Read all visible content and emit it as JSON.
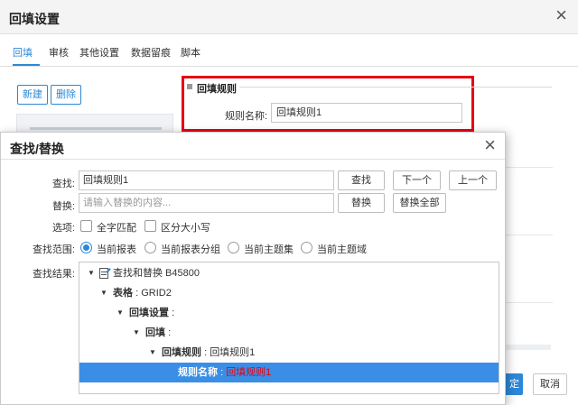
{
  "background_dialog": {
    "title": "回填设置",
    "close_glyph": "×",
    "tabs": [
      {
        "label": "回填",
        "active": true
      },
      {
        "label": "审核",
        "active": false
      },
      {
        "label": "其他设置",
        "active": false
      },
      {
        "label": "数据留痕",
        "active": false
      },
      {
        "label": "脚本",
        "active": false
      }
    ],
    "new_button": "新建",
    "delete_button": "删除",
    "section_title": "回填规则",
    "rule_name_label": "规则名称:",
    "rule_name_value": "回填规则1",
    "confirm_button_fragment": "定",
    "cancel_button": "取消"
  },
  "find_replace": {
    "title": "查找/替换",
    "close_glyph": "×",
    "find_label": "查找:",
    "find_value": "回填规则1",
    "find_button": "查找",
    "next_button": "下一个",
    "prev_button": "上一个",
    "replace_label": "替换:",
    "replace_placeholder": "请输入替换的内容...",
    "replace_button": "替换",
    "replace_all_button": "替换全部",
    "options_label": "选项:",
    "options": [
      {
        "label": "全字匹配",
        "checked": false
      },
      {
        "label": "区分大小写",
        "checked": false
      }
    ],
    "scope_label": "查找范围:",
    "scopes": [
      {
        "label": "当前报表",
        "checked": true
      },
      {
        "label": "当前报表分组",
        "checked": false
      },
      {
        "label": "当前主题集",
        "checked": false
      },
      {
        "label": "当前主题域",
        "checked": false
      }
    ],
    "results_label": "查找结果:",
    "results": {
      "root": "查找和替换 B45800",
      "rows": [
        {
          "key": "表格",
          "sep": ":",
          "value": "GRID2"
        },
        {
          "key": "回填设置",
          "sep": ":",
          "value": ""
        },
        {
          "key": "回填",
          "sep": ":",
          "value": ""
        },
        {
          "key": "回填规则",
          "sep": ":",
          "value": "回填规则1"
        },
        {
          "key": "规则名称",
          "sep": ":",
          "value": "回填规则1",
          "selected": true
        }
      ]
    }
  },
  "colors": {
    "accent": "#2b88d8",
    "highlight_border": "#e60012",
    "selection": "#3a8ee6",
    "match_text": "#e60012"
  }
}
